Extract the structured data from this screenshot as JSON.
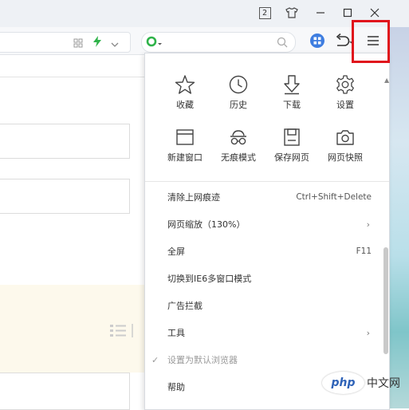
{
  "titlebar": {
    "badge": "2",
    "shirt_icon": "shirt-icon",
    "minimize_icon": "minimize-icon",
    "maximize_icon": "maximize-icon",
    "close_icon": "close-icon"
  },
  "toolbar": {
    "grid_icon": "grid-icon",
    "bolt_icon": "bolt-icon",
    "chevron_icon": "chevron-down-icon",
    "search_engine_icon": "search-engine-icon",
    "search_icon": "search-icon",
    "extension_icon": "extension-icon",
    "undo_icon": "undo-icon",
    "menu_icon": "hamburger-menu-icon",
    "accent": "#2fb34a"
  },
  "menu": {
    "quick_row1": [
      {
        "label": "收藏",
        "icon": "star-icon"
      },
      {
        "label": "历史",
        "icon": "clock-icon"
      },
      {
        "label": "下载",
        "icon": "download-icon"
      },
      {
        "label": "设置",
        "icon": "gear-icon"
      }
    ],
    "quick_row2": [
      {
        "label": "新建窗口",
        "icon": "new-window-icon"
      },
      {
        "label": "无痕模式",
        "icon": "incognito-icon"
      },
      {
        "label": "保存网页",
        "icon": "save-icon"
      },
      {
        "label": "网页快照",
        "icon": "camera-icon"
      }
    ],
    "items": [
      {
        "label": "清除上网痕迹",
        "shortcut": "Ctrl+Shift+Delete"
      },
      {
        "label": "网页缩放（130%）",
        "arrow": "›"
      },
      {
        "label": "全屏",
        "shortcut": "F11"
      },
      {
        "label": "切换到IE6多窗口模式"
      },
      {
        "label": "广告拦截"
      },
      {
        "label": "工具",
        "arrow": "›"
      },
      {
        "label": "设置为默认浏览器",
        "check": "✓"
      },
      {
        "label": "帮助"
      }
    ]
  },
  "watermark": {
    "logo": "php",
    "text": "中文网"
  }
}
